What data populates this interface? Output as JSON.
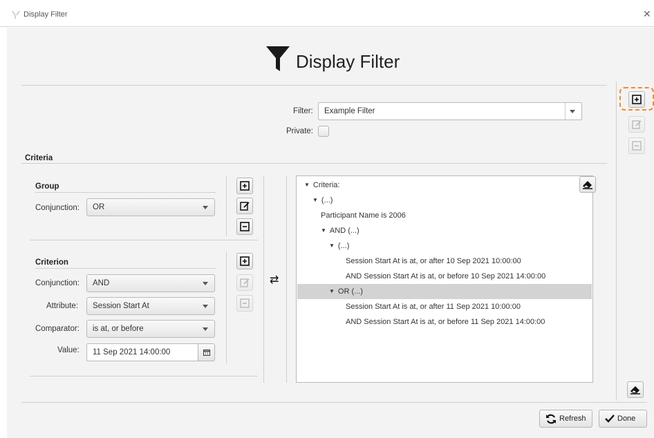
{
  "window": {
    "title": "Display Filter"
  },
  "header": {
    "title": "Display Filter"
  },
  "filter": {
    "label": "Filter:",
    "value": "Example Filter",
    "private_label": "Private:"
  },
  "criteria": {
    "title": "Criteria"
  },
  "group": {
    "title": "Group",
    "conjunction_label": "Conjunction:",
    "conjunction_value": "OR"
  },
  "criterion": {
    "title": "Criterion",
    "conjunction_label": "Conjunction:",
    "conjunction_value": "AND",
    "attribute_label": "Attribute:",
    "attribute_value": "Session Start At",
    "comparator_label": "Comparator:",
    "comparator_value": "is at, or before",
    "value_label": "Value:",
    "value_value": "11 Sep 2021 14:00:00"
  },
  "tree": [
    {
      "text": "Criteria:",
      "indent": 0,
      "toggle": true,
      "selected": false
    },
    {
      "text": "(...)",
      "indent": 1,
      "toggle": true,
      "selected": false
    },
    {
      "text": "Participant Name is 2006",
      "indent": 2,
      "toggle": false,
      "selected": false
    },
    {
      "text": "AND (...)",
      "indent": 2,
      "toggle": true,
      "selected": false
    },
    {
      "text": "(...)",
      "indent": 3,
      "toggle": true,
      "selected": false
    },
    {
      "text": "Session Start At is at, or after 10 Sep 2021 10:00:00",
      "indent": 4,
      "toggle": false,
      "selected": false
    },
    {
      "text": "AND Session Start At is at, or before 10 Sep 2021 14:00:00",
      "indent": 4,
      "toggle": false,
      "selected": false
    },
    {
      "text": "OR (...)",
      "indent": 3,
      "toggle": true,
      "selected": true
    },
    {
      "text": "Session Start At is at, or after 11 Sep 2021 10:00:00",
      "indent": 4,
      "toggle": false,
      "selected": false
    },
    {
      "text": "AND Session Start At is at, or before 11 Sep 2021 14:00:00",
      "indent": 4,
      "toggle": false,
      "selected": false
    }
  ],
  "buttons": {
    "refresh": "Refresh",
    "done": "Done"
  },
  "colors": {
    "accent_highlight": "#f08c2e",
    "selected_row": "#d3d3d3",
    "background": "#f3f3f3"
  }
}
